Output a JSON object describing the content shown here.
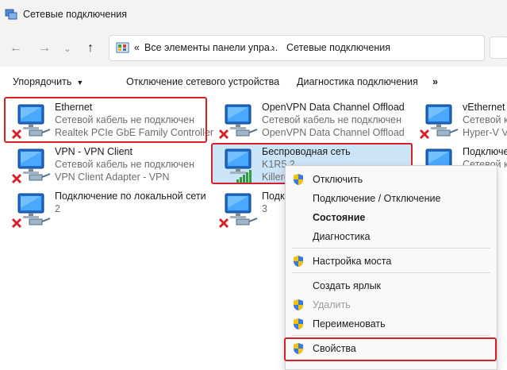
{
  "window": {
    "title": "Сетевые подключения"
  },
  "nav": {
    "back_icon": "arrow-left",
    "forward_icon": "arrow-right",
    "history_icon": "chevron-down",
    "up_icon": "arrow-up"
  },
  "address": {
    "overflow": "«",
    "crumb1": "Все элементы панели упра...",
    "sep": "›",
    "crumb2": "Сетевые подключения"
  },
  "toolbar": {
    "organize": "Упорядочить",
    "disable": "Отключение сетевого устройства",
    "diagnose": "Диагностика подключения",
    "more": "»"
  },
  "connections": [
    {
      "name": "Ethernet",
      "status": "Сетевой кабель не подключен",
      "device": "Realtek PCIe GbE Family Controller",
      "state": "disconnected"
    },
    {
      "name": "OpenVPN Data Channel Offload",
      "status": "Сетевой кабель не подключен",
      "device": "OpenVPN Data Channel Offload",
      "state": "disconnected"
    },
    {
      "name": "vEthernet (V",
      "status": "Сетевой кабел",
      "device": "Hyper-V Vir",
      "state": "disconnected"
    },
    {
      "name": "VPN - VPN Client",
      "status": "Сетевой кабель не подключен",
      "device": "VPN Client Adapter - VPN",
      "state": "disconnected"
    },
    {
      "name": "Беспроводная сеть",
      "status": "K1R5 2",
      "device": "Killer(",
      "state": "wireless"
    },
    {
      "name": "Подключе",
      "status": "Сетевой к",
      "device": "",
      "state": "disconnected"
    },
    {
      "name": "Подключение по локальной сети",
      "status": "2",
      "device": "",
      "state": "disconnected"
    },
    {
      "name": "Подключение по локальной сети",
      "status": "3",
      "device": "",
      "state": "disconnected"
    }
  ],
  "context_menu": [
    {
      "label": "Отключить",
      "icon": "shield-icon",
      "style": "normal"
    },
    {
      "label": "Подключение / Отключение",
      "icon": "",
      "style": "normal"
    },
    {
      "label": "Состояние",
      "icon": "",
      "style": "bold"
    },
    {
      "label": "Диагностика",
      "icon": "",
      "style": "normal"
    },
    {
      "label": "Настройка моста",
      "icon": "shield-icon",
      "style": "normal"
    },
    {
      "label": "Создать ярлык",
      "icon": "",
      "style": "normal"
    },
    {
      "label": "Удалить",
      "icon": "shield-icon",
      "style": "disabled"
    },
    {
      "label": "Переименовать",
      "icon": "shield-icon",
      "style": "normal"
    },
    {
      "label": "Свойства",
      "icon": "shield-icon",
      "style": "normal"
    }
  ],
  "colors": {
    "highlight_box": "#d3222a",
    "selection": "#cce4f7",
    "error_x": "#d3222a",
    "signal": "#2e9e3e"
  }
}
